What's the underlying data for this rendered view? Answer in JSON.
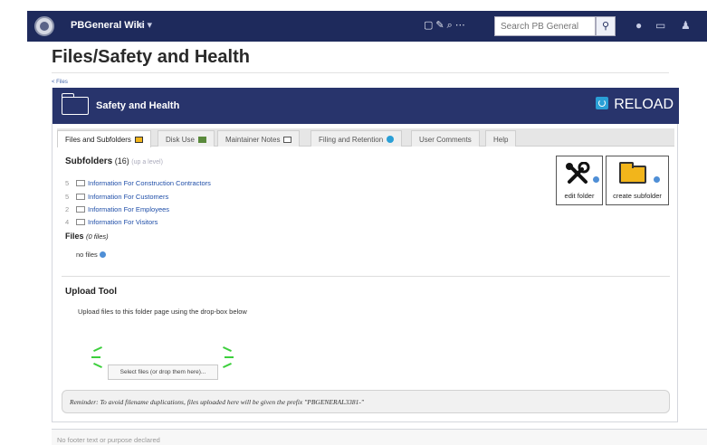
{
  "navbar": {
    "site_name": "PBGeneral Wiki",
    "menu_label": "≡ ▾",
    "icons": [
      "new-page-icon",
      "edit-icon",
      "discuss-icon",
      "more-icon",
      "bell-icon",
      "chat-icon",
      "user-icon"
    ],
    "search": {
      "placeholder": "Search PB General"
    },
    "bg_color": "#1e2a5c"
  },
  "page": {
    "title": "Files/Safety and Health",
    "breadcrumb": "< Files"
  },
  "folder": {
    "title": "Safety and Health",
    "reload_label": "RELOAD",
    "header_color": "#28346c",
    "tabs": [
      {
        "label": "Files and Subfolders",
        "icon": "folder-icon",
        "active": true
      },
      {
        "label": "Disk Use",
        "icon": "chart-icon"
      },
      {
        "label": "Maintainer Notes",
        "icon": "note-icon"
      },
      {
        "label": "Filing and Retention",
        "icon": "info-icon"
      },
      {
        "label": "User Comments"
      },
      {
        "label": "Help"
      }
    ],
    "subfolders_heading": "Subfolders",
    "subfolders_count": "(16)",
    "up_level": "(up a level)",
    "subfolders": [
      {
        "count": "5",
        "name": "Information For Construction Contractors"
      },
      {
        "count": "5",
        "name": "Information For Customers"
      },
      {
        "count": "2",
        "name": "Information For Employees"
      },
      {
        "count": "4",
        "name": "Information For Visitors"
      }
    ],
    "files_heading": "Files",
    "files_count": "(0 files)",
    "no_files": "no files",
    "actions": {
      "edit": "edit folder",
      "create": "create subfolder"
    },
    "upload": {
      "heading": "Upload Tool",
      "description": "Upload files to this folder page using the drop-box below",
      "select_label": "Select files (or drop them here)..."
    },
    "reminder": "Reminder: To avoid filename duplications, files uploaded here will be given the prefix \"PBGENERAL3381-\""
  },
  "footer": {
    "text": "No footer text or purpose declared"
  }
}
